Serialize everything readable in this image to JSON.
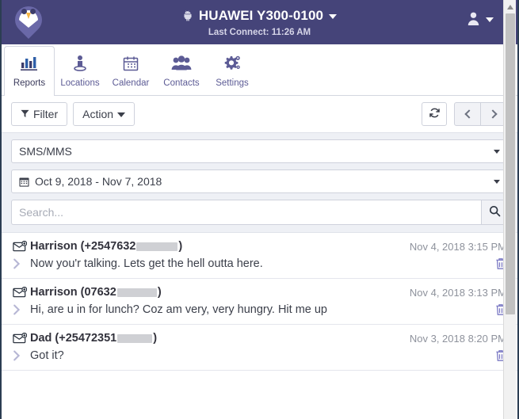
{
  "theme": {
    "header_bg": "#454479",
    "accent": "#5c5b95",
    "panel_bg": "#eef0f5",
    "trash_color": "#7b79c4",
    "border": "#cfd2dc"
  },
  "header": {
    "logo_name": "owl-pin-logo",
    "device_icon": "android-icon",
    "device_name": "HUAWEI Y300-0100",
    "last_connect": "Last Connect: 11:26 AM",
    "account_icon": "user-avatar-icon"
  },
  "tabs": [
    {
      "label": "Reports",
      "icon": "bar-chart-icon",
      "active": true
    },
    {
      "label": "Locations",
      "icon": "person-pin-icon",
      "active": false
    },
    {
      "label": "Calendar",
      "icon": "calendar-icon",
      "active": false
    },
    {
      "label": "Contacts",
      "icon": "people-icon",
      "active": false
    },
    {
      "label": "Settings",
      "icon": "gears-icon",
      "active": false
    }
  ],
  "toolbar": {
    "filter_label": "Filter",
    "filter_icon": "funnel-icon",
    "action_label": "Action",
    "refresh_icon": "refresh-icon",
    "prev_icon": "chevron-left-icon",
    "next_icon": "chevron-right-icon"
  },
  "filters": {
    "report_type": "SMS/MMS",
    "date_range": "Oct 9, 2018 - Nov 7, 2018",
    "date_icon": "calendar-icon",
    "search_value": "",
    "search_placeholder": "Search...",
    "search_icon": "search-icon"
  },
  "messages": [
    {
      "icon": "envelope-incoming-icon",
      "sender_prefix": "Harrison (+2547632",
      "sender_suffix": ")",
      "redacted": true,
      "date": "Nov 4, 2018 3:15 PM",
      "text": "Now you'r talking. Lets get the hell outta here.",
      "expand_icon": "chevron-right-icon",
      "delete_icon": "trash-icon"
    },
    {
      "icon": "envelope-incoming-icon",
      "sender_prefix": "Harrison (07632",
      "sender_suffix": ")",
      "redacted": true,
      "date": "Nov 4, 2018 3:13 PM",
      "text": "Hi, are u in for lunch? Coz am very, very hungry. Hit me up",
      "expand_icon": "chevron-right-icon",
      "delete_icon": "trash-icon"
    },
    {
      "icon": "envelope-incoming-icon",
      "sender_prefix": "Dad (+25472351",
      "sender_suffix": ")",
      "redacted": true,
      "date": "Nov 3, 2018 8:20 PM",
      "text": "Got it?",
      "expand_icon": "chevron-right-icon",
      "delete_icon": "trash-icon"
    }
  ],
  "scrollbar": {
    "up_arrow_icon": "scroll-up-arrow-icon",
    "thumb_name": "scroll-thumb"
  }
}
